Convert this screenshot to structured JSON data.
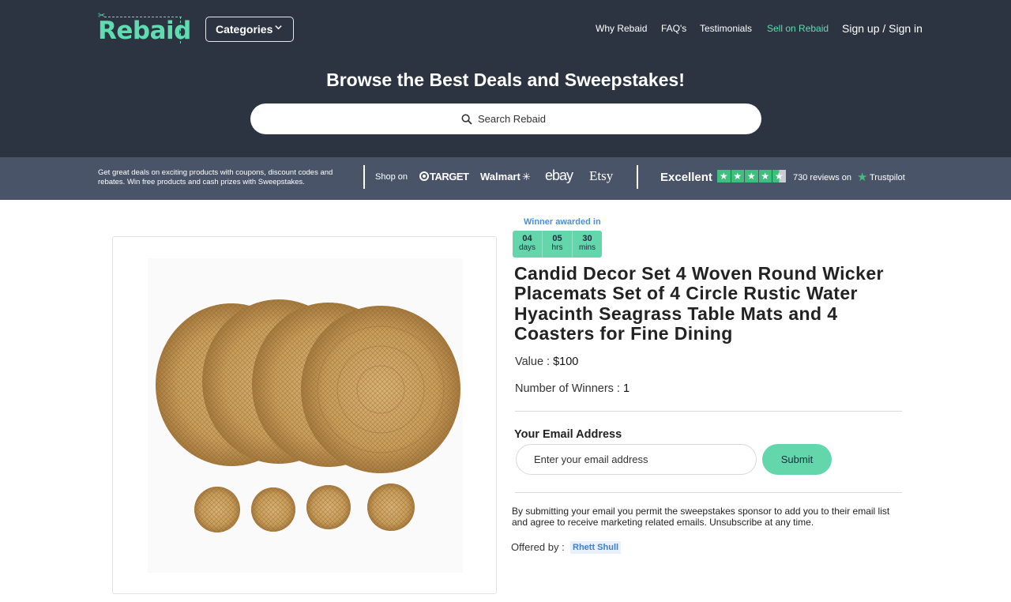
{
  "header": {
    "logo_text": "Rebaid",
    "categories_label": "Categories",
    "nav": [
      {
        "label": "Why Rebaid"
      },
      {
        "label": "FAQ's"
      },
      {
        "label": "Testimonials"
      },
      {
        "label": "Sell on Rebaid"
      }
    ],
    "signin_label": "Sign up / Sign in",
    "hero_title": "Browse the Best Deals and Sweepstakes!",
    "search_placeholder": "Search Rebaid",
    "colors": {
      "background": "#2d3441",
      "accent": "#5fdcb0"
    }
  },
  "strip": {
    "description": "Get great deals on exciting products with coupons, discount codes and rebates. Win free products and cash prizes with Sweepstakes.",
    "shop_on_label": "Shop on",
    "stores": [
      "TARGET",
      "Walmart",
      "ebay",
      "Etsy"
    ],
    "rating_label": "Excellent",
    "rating_stars": 4.5,
    "reviews_text": "730 reviews on",
    "trustpilot_label": "Trustpilot",
    "colors": {
      "background": "#4a5468",
      "trustpilot_green": "#3dbf7d"
    }
  },
  "product": {
    "image_icon": "woven-placemats-image",
    "winner_label": "Winner awarded in",
    "countdown": [
      {
        "value": "04",
        "unit": "days"
      },
      {
        "value": "05",
        "unit": "hrs"
      },
      {
        "value": "30",
        "unit": "mins"
      }
    ],
    "title": "Candid Decor Set 4 Woven Round Wicker Placemats Set of 4 Circle Rustic Water Hyacinth Seagrass Table Mats and 4 Coasters for Fine Dining",
    "value_label": "Value :",
    "value": "$100",
    "winners_label": "Number of Winners :",
    "winners": "1",
    "email_label": "Your Email Address",
    "email_placeholder": "Enter your email address",
    "submit_label": "Submit",
    "disclaimer": "By submitting your email you permit the sweepstakes sponsor to add you to their email list and agree to receive marketing related emails. Unsubscribe at any time.",
    "offered_label": "Offered by :",
    "offered_by": "Rhett Shull"
  }
}
